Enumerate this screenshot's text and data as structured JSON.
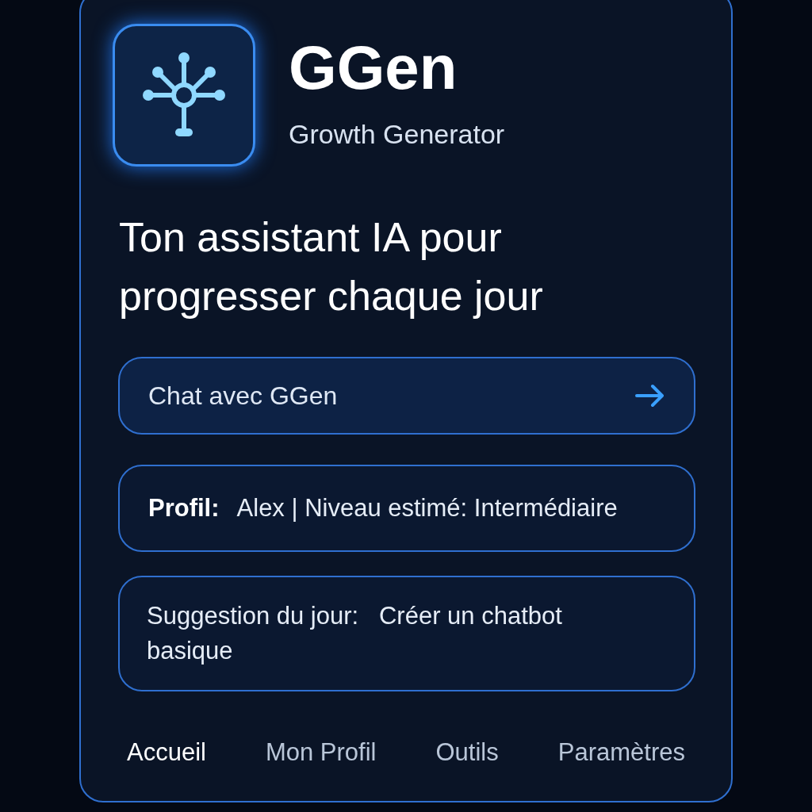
{
  "app": {
    "name": "GGen",
    "subtitle": "Growth Generator"
  },
  "headline": "Ton assistant IA pour progresser chaque jour",
  "chat_button": {
    "label": "Chat avec GGen"
  },
  "profile": {
    "label": "Profil:",
    "value": "Alex | Niveau estimé: Intermédiaire"
  },
  "suggestion": {
    "text": "Suggestion du jour:   Créer un chatbot basique"
  },
  "nav": [
    {
      "label": "Accueil",
      "selected": true
    },
    {
      "label": "Mon Profil",
      "selected": false
    },
    {
      "label": "Outils",
      "selected": false
    },
    {
      "label": "Paramètres",
      "selected": false
    }
  ]
}
